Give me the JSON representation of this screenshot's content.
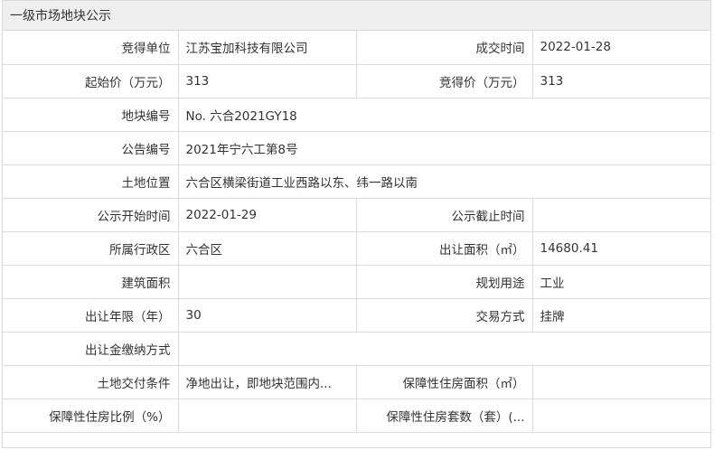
{
  "title": "一级市场地块公示",
  "fields": {
    "bidder_label": "竞得单位",
    "bidder_value": "江苏宝加科技有限公司",
    "deal_time_label": "成交时间",
    "deal_time_value": "2022-01-28",
    "start_price_label": "起始价（万元）",
    "start_price_value": "313",
    "win_price_label": "竞得价（万元）",
    "win_price_value": "313",
    "parcel_no_label": "地块编号",
    "parcel_no_value": "No. 六合2021GY18",
    "notice_no_label": "公告编号",
    "notice_no_value": "2021年宁六工第8号",
    "location_label": "土地位置",
    "location_value": "六合区横梁街道工业西路以东、纬一路以南",
    "pub_start_label": "公示开始时间",
    "pub_start_value": "2022-01-29",
    "pub_end_label": "公示截止时间",
    "pub_end_value": "",
    "district_label": "所属行政区",
    "district_value": "六合区",
    "area_label": "出让面积（㎡）",
    "area_value": "14680.41",
    "build_area_label": "建筑面积",
    "build_area_value": "",
    "usage_label": "规划用途",
    "usage_value": "工业",
    "term_label": "出让年限（年）",
    "term_value": "30",
    "trade_mode_label": "交易方式",
    "trade_mode_value": "挂牌",
    "payment_label": "出让金缴纳方式",
    "payment_value": "",
    "delivery_label": "土地交付条件",
    "delivery_value": "净地出让，即地块范围内...",
    "housing_area_label": "保障性住房面积（㎡）",
    "housing_area_value": "",
    "housing_ratio_label": "保障性住房比例（%）",
    "housing_ratio_value": "",
    "housing_units_label": "保障性住房套数（套）(...",
    "housing_units_value": ""
  }
}
